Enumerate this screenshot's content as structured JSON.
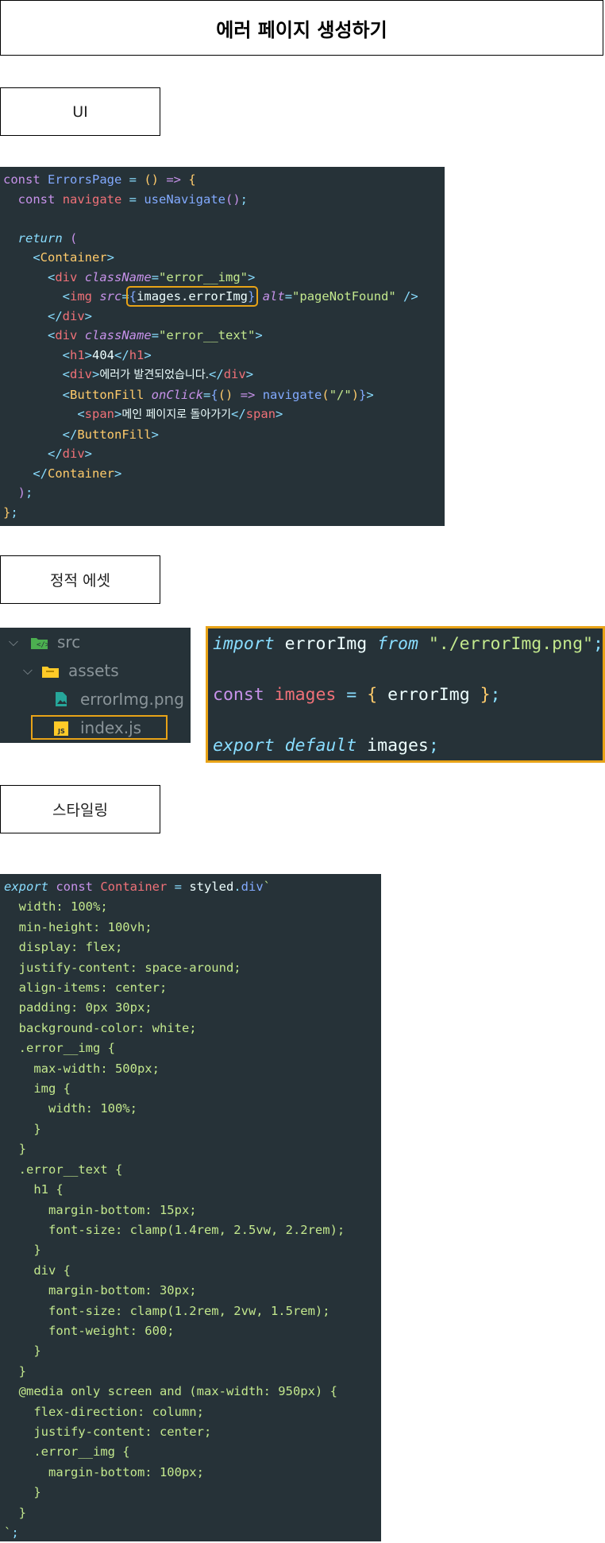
{
  "page": {
    "title": "에러 페이지 생성하기",
    "section_ui": "UI",
    "section_assets": "정적 에셋",
    "section_styling": "스타일링"
  },
  "code_errors_page": {
    "l1": {
      "kw": "const",
      "name": "ErrorsPage",
      "eq": " = ",
      "paren": "()",
      "arrow": " => ",
      "brace": "{"
    },
    "l2": {
      "kw": "const",
      "var": "navigate",
      "eq": " = ",
      "fn": "useNavigate",
      "paren": "()",
      "semi": ";"
    },
    "l4": {
      "kw": "return",
      "paren": " ("
    },
    "l5": {
      "open": "<",
      "comp": "Container",
      "close": ">"
    },
    "l6": {
      "open": "<",
      "tag": "div",
      "attr": "className",
      "eq": "=",
      "str": "\"error__img\"",
      "close": ">"
    },
    "l7": {
      "open": "<",
      "tag": "img",
      "attr": "src",
      "eq": "=",
      "lb": "{",
      "expr": "images.errorImg",
      "rb": "}",
      "attr2": "alt",
      "eq2": "=",
      "str2": "\"pageNotFound\"",
      "close": " />"
    },
    "l8": {
      "open": "</",
      "tag": "div",
      "close": ">"
    },
    "l9": {
      "open": "<",
      "tag": "div",
      "attr": "className",
      "eq": "=",
      "str": "\"error__text\"",
      "close": ">"
    },
    "l10": {
      "open": "<",
      "tag": "h1",
      "close": ">",
      "text": "404",
      "open2": "</",
      "tag2": "h1",
      "close2": ">"
    },
    "l11": {
      "open": "<",
      "tag": "div",
      "close": ">",
      "text": "에러가 발견되었습니다.",
      "open2": "</",
      "tag2": "div",
      "close2": ">"
    },
    "l12": {
      "open": "<",
      "comp": "ButtonFill",
      "attr": "onClick",
      "eq": "=",
      "lb": "{",
      "paren": "()",
      "arrow": " => ",
      "fn": "navigate",
      "lp": "(",
      "str": "\"/\"",
      "rp": ")",
      "rb": "}",
      "close": ">"
    },
    "l13": {
      "open": "<",
      "tag": "span",
      "close": ">",
      "text": "메인 페이지로 돌아가기",
      "open2": "</",
      "tag2": "span",
      "close2": ">"
    },
    "l14": {
      "open": "</",
      "comp": "ButtonFill",
      "close": ">"
    },
    "l15": {
      "open": "</",
      "tag": "div",
      "close": ">"
    },
    "l16": {
      "open": "</",
      "comp": "Container",
      "close": ">"
    },
    "l17": {
      "paren": ")",
      "semi": ";"
    },
    "l18": {
      "brace": "}",
      "semi": ";"
    }
  },
  "file_tree": {
    "items": [
      {
        "label": "src",
        "icon": "folder-src-icon"
      },
      {
        "label": "assets",
        "icon": "folder-icon"
      },
      {
        "label": "errorImg.png",
        "icon": "image-file-icon"
      },
      {
        "label": "index.js",
        "icon": "js-file-icon"
      }
    ]
  },
  "code_images": {
    "l1": {
      "kw": "import",
      "name": " errorImg ",
      "kw2": "from",
      "str": " \"./errorImg.png\"",
      "semi": ";"
    },
    "l3": {
      "kw": "const",
      "var": " images",
      "eq": " = ",
      "lb": "{",
      "name": " errorImg ",
      "rb": "}",
      "semi": ";"
    },
    "l5": {
      "kw": "export",
      "kw2": " default",
      "name": " images",
      "semi": ";"
    }
  },
  "code_styled": {
    "l1": {
      "kw": "export",
      "kw2": " const",
      "var": " Container",
      "eq": " = ",
      "name": "styled",
      "dot": ".",
      "fn": "div",
      "tick": "`"
    },
    "css": [
      "  width: 100%;",
      "  min-height: 100vh;",
      "  display: flex;",
      "  justify-content: space-around;",
      "  align-items: center;",
      "  padding: 0px 30px;",
      "  background-color: white;",
      "  .error__img {",
      "    max-width: 500px;",
      "    img {",
      "      width: 100%;",
      "    }",
      "  }",
      "  .error__text {",
      "    h1 {",
      "      margin-bottom: 15px;",
      "      font-size: clamp(1.4rem, 2.5vw, 2.2rem);",
      "    }",
      "    div {",
      "      margin-bottom: 30px;",
      "      font-size: clamp(1.2rem, 2vw, 1.5rem);",
      "      font-weight: 600;",
      "    }",
      "  }",
      "  @media only screen and (max-width: 950px) {",
      "    flex-direction: column;",
      "    justify-content: center;",
      "    .error__img {",
      "      margin-bottom: 100px;",
      "    }",
      "  }"
    ],
    "end": {
      "tick": "`",
      "semi": ";"
    }
  },
  "colors": {
    "editor_bg": "#263238",
    "highlight": "#e8a317"
  }
}
